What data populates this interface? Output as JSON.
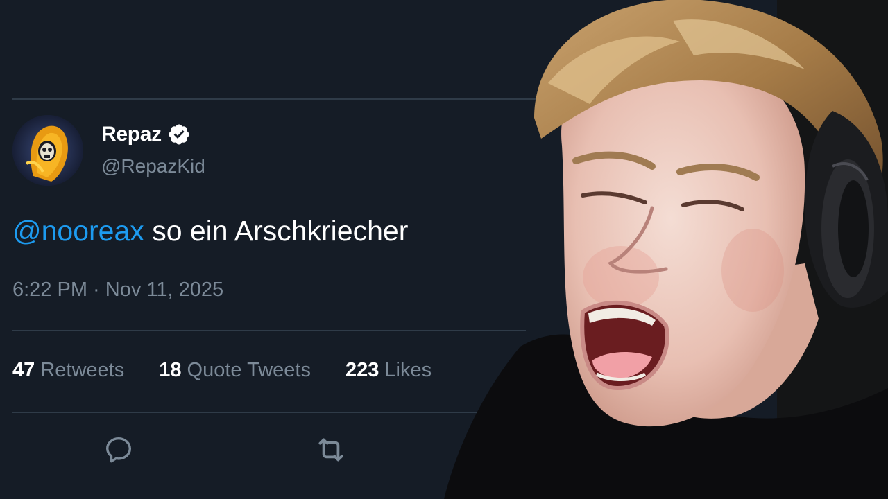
{
  "tweet": {
    "display_name": "Repaz",
    "handle": "@RepazKid",
    "verified": true,
    "text_mention": "@nooreax",
    "text_body": " so ein Arschkriecher",
    "timestamp": "6:22 PM · Nov 11, 2025",
    "stats": [
      {
        "count": "47",
        "label": " Retweets"
      },
      {
        "count": "18",
        "label": " Quote Tweets"
      },
      {
        "count": "223",
        "label": " Likes"
      }
    ],
    "actions": [
      {
        "icon": "reply-icon"
      },
      {
        "icon": "retweet-icon"
      }
    ]
  },
  "colors": {
    "background": "#151c26",
    "mention": "#1d9bf0",
    "secondary_text": "#7c8a98",
    "divider": "#2f3b48"
  },
  "overlay": {
    "description_icon": "streamer-photo"
  }
}
